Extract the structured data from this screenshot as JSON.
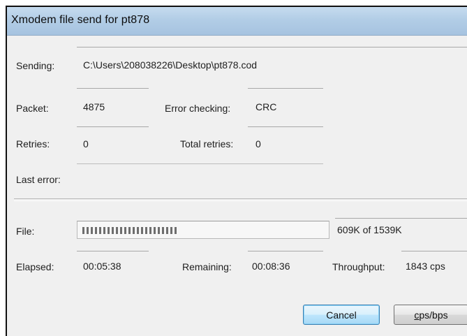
{
  "window": {
    "title": "Xmodem file send for pt878"
  },
  "sending": {
    "label": "Sending:",
    "value": "C:\\Users\\208038226\\Desktop\\pt878.cod"
  },
  "packet": {
    "label": "Packet:",
    "value": "4875"
  },
  "error_checking": {
    "label": "Error checking:",
    "value": "CRC"
  },
  "retries": {
    "label": "Retries:",
    "value": "0"
  },
  "total_retries": {
    "label": "Total retries:",
    "value": "0"
  },
  "last_error": {
    "label": "Last error:",
    "value": ""
  },
  "file": {
    "label": "File:",
    "progress_fraction": 0.396,
    "size_text": "609K of 1539K"
  },
  "elapsed": {
    "label": "Elapsed:",
    "value": "00:05:38"
  },
  "remaining": {
    "label": "Remaining:",
    "value": "00:08:36"
  },
  "throughput": {
    "label": "Throughput:",
    "value": "1843 cps"
  },
  "buttons": {
    "cancel": "Cancel",
    "cps_bps_mnemonic": "c",
    "cps_bps_rest": "ps/bps"
  },
  "colors": {
    "titlebar": "#b2cde6",
    "default_button_border": "#3c7fb1",
    "dialog_background": "#f0f0f0"
  }
}
